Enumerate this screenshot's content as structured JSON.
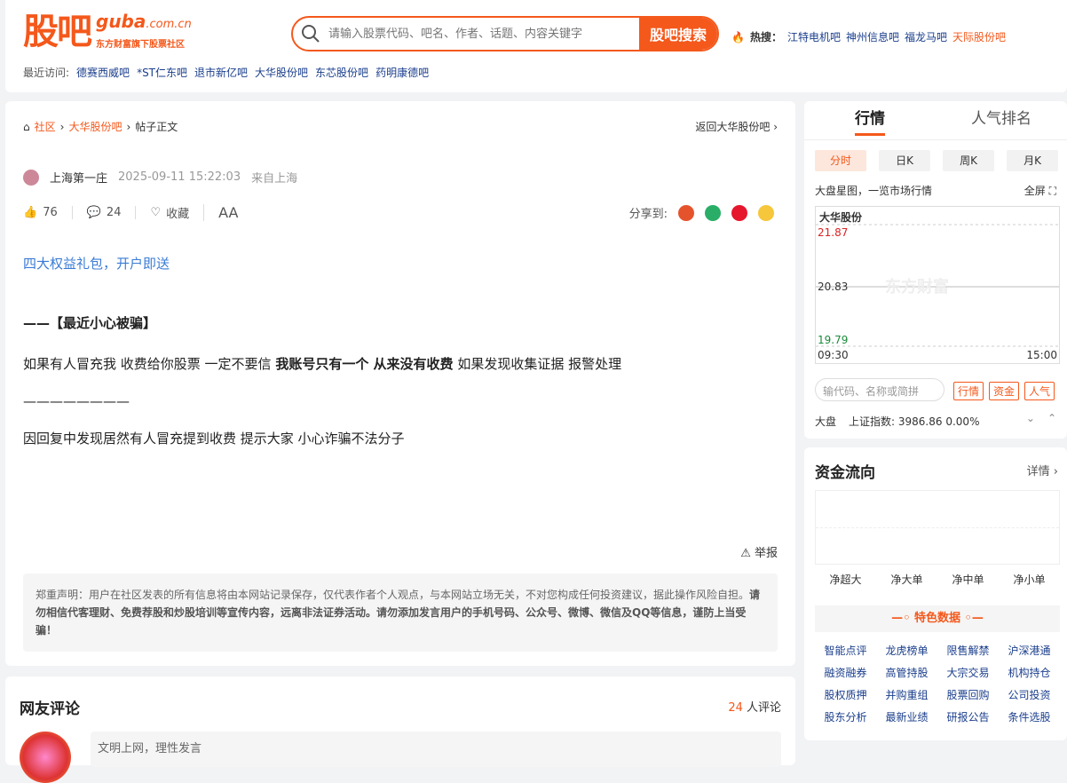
{
  "logo": {
    "cn": "股吧",
    "en": "guba",
    "en_suffix": ".com.cn",
    "sub": "东方财富旗下股票社区"
  },
  "search": {
    "placeholder": "请输入股票代码、吧名、作者、话题、内容关键字",
    "button": "股吧搜索"
  },
  "hot": {
    "label": "热搜：",
    "items": [
      "江特电机吧",
      "神州信息吧",
      "福龙马吧",
      "天际股份吧"
    ]
  },
  "recent": {
    "label": "最近访问:",
    "items": [
      "德赛西威吧",
      "*ST仁东吧",
      "退市新亿吧",
      "大华股份吧",
      "东芯股份吧",
      "药明康德吧"
    ]
  },
  "breadcrumb": {
    "home": "社区",
    "bar": "大华股份吧",
    "current": "帖子正文"
  },
  "back": "返回大华股份吧",
  "post": {
    "author": "上海第一庄",
    "time": "2025-09-11 15:22:03",
    "from": "来自上海",
    "likes": "76",
    "comments": "24",
    "collect": "收藏",
    "font": "AA",
    "share_label": "分享到:",
    "promo": "四大权益礼包，开户即送",
    "title": "——【最近小心被骗】",
    "p1a": "如果有人冒充我 收费给你股票  一定不要信  ",
    "p1b": "我账号只有一个 从来没有收费",
    "p1c": "  如果发现收集证据 报警处理",
    "divider": "————————",
    "p2": "因回复中发现居然有人冒充提到收费 提示大家 小心诈骗不法分子",
    "report": "举报",
    "notice_a": "郑重声明：用户在社区发表的所有信息将由本网站记录保存，仅代表作者个人观点，与本网站立场无关，不对您构成任何投资建议，据此操作风险自担。",
    "notice_b": "请勿相信代客理财、免费荐股和炒股培训等宣传内容，远离非法证券活动。请勿添加发言用户的手机号码、公众号、微博、微信及QQ等信息，谨防上当受骗！"
  },
  "comments": {
    "title": "网友评论",
    "count": "24",
    "count_suffix": " 人评论",
    "placeholder": "文明上网，理性发言"
  },
  "side": {
    "tabs": [
      "行情",
      "人气排名"
    ],
    "ktabs": [
      "分时",
      "日K",
      "周K",
      "月K"
    ],
    "market": "大盘星图，一览市场行情",
    "full": "全屏",
    "chart": {
      "name": "大华股份",
      "high": "21.87",
      "mid": "20.83",
      "low": "19.79",
      "start": "09:30",
      "end": "15:00",
      "watermark": "东方财富"
    },
    "search_placeholder": "输代码、名称或简拼",
    "btns": [
      "行情",
      "资金",
      "人气"
    ],
    "idx_label": "大盘",
    "idx_name": "上证指数:",
    "idx_val": "3986.86",
    "idx_pct": "0.00%"
  },
  "flow": {
    "title": "资金流向",
    "more": "详情",
    "labels": [
      "净超大",
      "净大单",
      "净中单",
      "净小单"
    ],
    "special": "特色数据",
    "items": [
      "智能点评",
      "龙虎榜单",
      "限售解禁",
      "沪深港通",
      "融资融券",
      "高管持股",
      "大宗交易",
      "机构持仓",
      "股权质押",
      "并购重组",
      "股票回购",
      "公司投资",
      "股东分析",
      "最新业绩",
      "研报公告",
      "条件选股"
    ]
  },
  "colors": {
    "brand": "#f4581b",
    "link": "#1a3e8c",
    "promo": "#3a7bd5"
  }
}
